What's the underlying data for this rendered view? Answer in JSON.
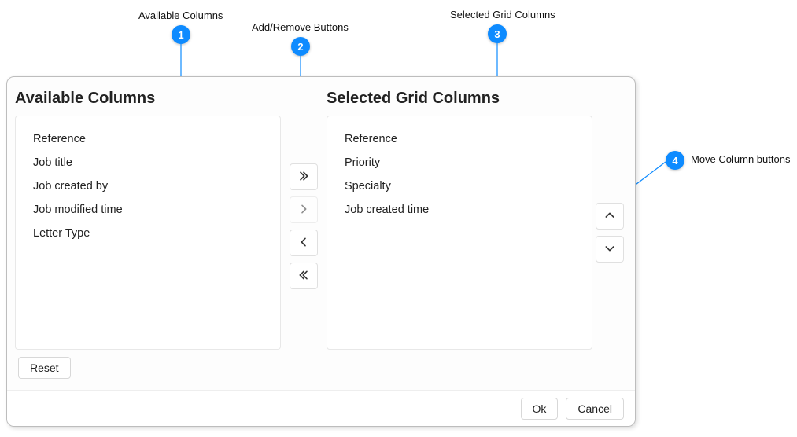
{
  "callouts": {
    "c1": {
      "label": "Available Columns",
      "num": "1"
    },
    "c2": {
      "label": "Add/Remove Buttons",
      "num": "2"
    },
    "c3": {
      "label": "Selected Grid Columns",
      "num": "3"
    },
    "c4": {
      "label": "Move Column buttons",
      "num": "4"
    }
  },
  "dialog": {
    "available": {
      "title": "Available Columns",
      "items": [
        "Reference",
        "Job title",
        "Job created by",
        "Job modified time",
        "Letter Type"
      ]
    },
    "selected": {
      "title": "Selected Grid Columns",
      "items": [
        "Reference",
        "Priority",
        "Specialty",
        "Job created time"
      ]
    },
    "buttons": {
      "reset": "Reset",
      "ok": "Ok",
      "cancel": "Cancel"
    }
  }
}
